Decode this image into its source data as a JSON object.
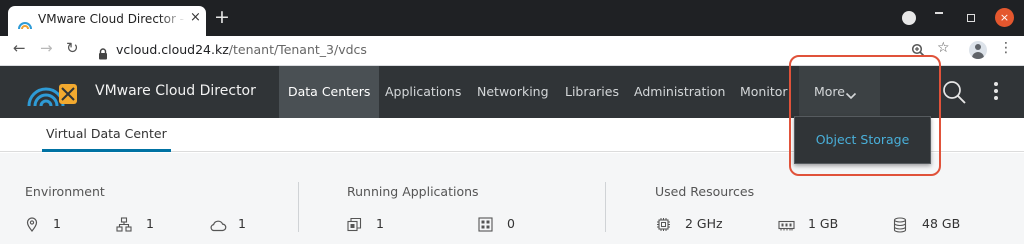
{
  "browser": {
    "tab": {
      "title": "VMware Cloud Director - VMware",
      "close_glyph": "×",
      "favicon": "vcd-favicon-icon"
    },
    "new_tab_glyph": "+",
    "window_controls": {
      "close_glyph": "×"
    },
    "address_bar": {
      "host": "vcloud.cloud24.kz",
      "path": "/tenant/Tenant_3/vdcs"
    },
    "nav_glyphs": {
      "back": "←",
      "forward": "→",
      "reload": "↻"
    },
    "toolbar_glyphs": {
      "bookmark": "☆",
      "menu": "⋮"
    }
  },
  "app": {
    "brand_name": "VMware Cloud Director",
    "nav": [
      {
        "label": "Data Centers",
        "active": true
      },
      {
        "label": "Applications"
      },
      {
        "label": "Networking"
      },
      {
        "label": "Libraries"
      },
      {
        "label": "Administration"
      },
      {
        "label": "Monitor"
      }
    ],
    "more_label": "More",
    "more_menu": [
      {
        "label": "Object Storage"
      }
    ],
    "subnav": {
      "tab": "Virtual Data Center"
    }
  },
  "summary": {
    "environment": {
      "title": "Environment",
      "stats": [
        {
          "icon": "location-pin-icon",
          "value": "1"
        },
        {
          "icon": "network-tree-icon",
          "value": "1"
        },
        {
          "icon": "cloud-icon",
          "value": "1"
        }
      ]
    },
    "running_applications": {
      "title": "Running Applications",
      "stats": [
        {
          "icon": "vm-stack-icon",
          "value": "1"
        },
        {
          "icon": "container-grid-icon",
          "value": "0"
        }
      ]
    },
    "used_resources": {
      "title": "Used Resources",
      "stats": [
        {
          "icon": "cpu-chip-icon",
          "value": "2 GHz"
        },
        {
          "icon": "memory-icon",
          "value": "1 GB"
        },
        {
          "icon": "storage-icon",
          "value": "48 GB"
        }
      ]
    }
  },
  "colors": {
    "header_bg": "#303437",
    "active_nav_bg": "#4a5054",
    "accent_blue": "#0072a3",
    "link_blue": "#49afd9",
    "highlight_red": "#e0523a",
    "browser_chrome": "#1f2124"
  }
}
